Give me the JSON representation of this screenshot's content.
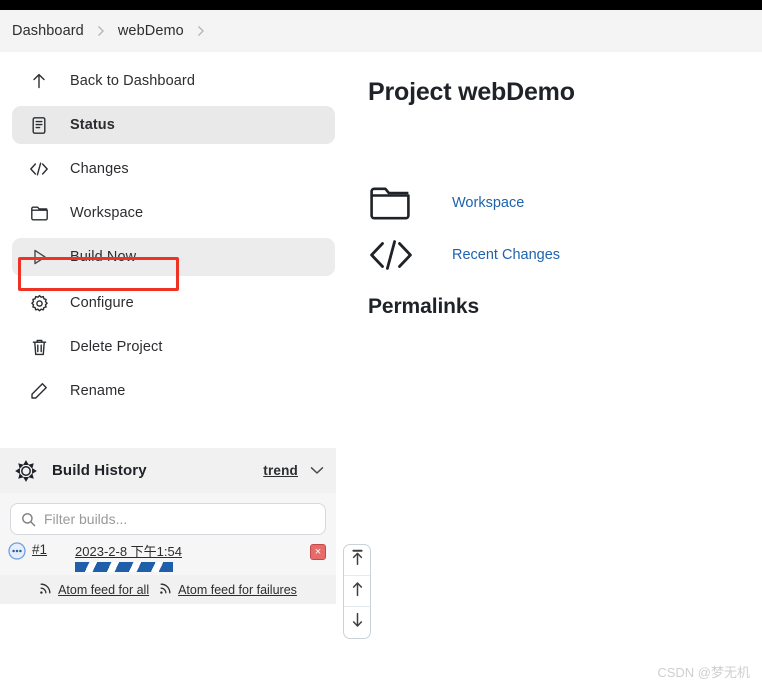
{
  "breadcrumb": {
    "items": [
      {
        "label": "Dashboard"
      },
      {
        "label": "webDemo"
      }
    ],
    "separator": "chevron-right-icon"
  },
  "sidebar": {
    "items": [
      {
        "label": "Back to Dashboard",
        "icon": "arrow-up-icon",
        "state": "normal"
      },
      {
        "label": "Status",
        "icon": "document-icon",
        "state": "active"
      },
      {
        "label": "Changes",
        "icon": "code-brackets-icon",
        "state": "normal"
      },
      {
        "label": "Workspace",
        "icon": "folder-icon",
        "state": "normal"
      },
      {
        "label": "Build Now",
        "icon": "play-triangle-icon",
        "state": "hovered"
      },
      {
        "label": "Configure",
        "icon": "gear-icon",
        "state": "normal"
      },
      {
        "label": "Delete Project",
        "icon": "trash-icon",
        "state": "normal"
      },
      {
        "label": "Rename",
        "icon": "pencil-icon",
        "state": "normal"
      }
    ]
  },
  "annotation": {
    "target": "Build Now",
    "color": "#ee3224"
  },
  "build_history": {
    "icon": "build-status-icon",
    "title": "Build History",
    "trend_label": "trend",
    "chevron": "chevron-down-icon",
    "filter": {
      "placeholder": "Filter builds...",
      "value": "",
      "icon": "search-icon"
    },
    "builds": [
      {
        "status_icon": "in-progress-icon",
        "number": "#1",
        "timestamp": "2023-2-8 下午1:54",
        "progress": "in-progress",
        "stop_label": "×"
      }
    ],
    "feeds": [
      {
        "label": "Atom feed for all",
        "icon": "rss-icon"
      },
      {
        "label": "Atom feed for failures",
        "icon": "rss-icon"
      }
    ]
  },
  "scroll_controls": {
    "buttons": [
      {
        "name": "scroll-to-top",
        "icon": "arrow-to-top-icon"
      },
      {
        "name": "scroll-up",
        "icon": "arrow-up-icon"
      },
      {
        "name": "scroll-down",
        "icon": "arrow-down-icon"
      }
    ]
  },
  "main": {
    "title": "Project webDemo",
    "links": [
      {
        "label": "Workspace",
        "icon": "folder-icon"
      },
      {
        "label": "Recent Changes",
        "icon": "code-brackets-icon"
      }
    ],
    "permalinks_title": "Permalinks"
  },
  "watermark": {
    "text": "CSDN @梦无机"
  },
  "colors": {
    "accent_link": "#1f62ad",
    "annotation_red": "#ee3224",
    "progress_blue": "#1f5fa9",
    "topbar": "#000000"
  }
}
